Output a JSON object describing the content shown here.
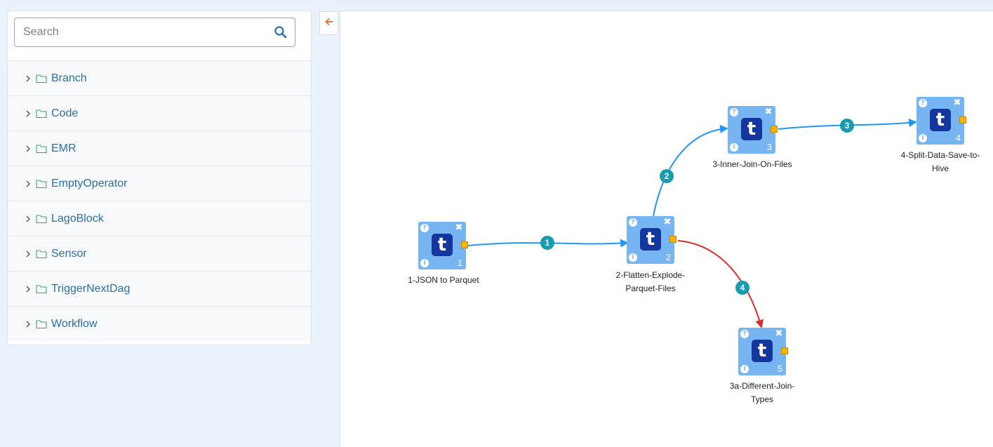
{
  "search": {
    "placeholder": "Search"
  },
  "sidebar": {
    "items": [
      {
        "label": "Branch"
      },
      {
        "label": "Code"
      },
      {
        "label": "EMR"
      },
      {
        "label": "EmptyOperator"
      },
      {
        "label": "LagoBlock"
      },
      {
        "label": "Sensor"
      },
      {
        "label": "TriggerNextDag"
      },
      {
        "label": "Workflow"
      }
    ]
  },
  "nodes": [
    {
      "logo": "t",
      "number": "1",
      "label": "1-JSON to Parquet"
    },
    {
      "logo": "t",
      "number": "2",
      "label": "2-Flatten-Explode-Parquet-Files"
    },
    {
      "logo": "t",
      "number": "3",
      "label": "3-Inner-Join-On-Files"
    },
    {
      "logo": "t",
      "number": "4",
      "label": "4-Split-Data-Save-to-Hive"
    },
    {
      "logo": "t",
      "number": "5",
      "label": "3a-Different-Join-Types"
    }
  ],
  "edges": [
    {
      "badge": "1",
      "from": "1",
      "to": "2",
      "color": "#2196f3"
    },
    {
      "badge": "2",
      "from": "2",
      "to": "3",
      "color": "#2196f3"
    },
    {
      "badge": "3",
      "from": "3",
      "to": "4",
      "color": "#2196f3"
    },
    {
      "badge": "4",
      "from": "2",
      "to": "5",
      "color": "#d32f2f"
    }
  ],
  "icons": {
    "search": "search-icon",
    "collapse": "arrow-left-icon",
    "folder": "folder-icon",
    "chevron": "chevron-right-icon",
    "help": "?",
    "info": "i",
    "close": "✖"
  },
  "colors": {
    "node": "#77b5f2",
    "logo": "#15369c",
    "port": "#f4b400",
    "badge": "#1a9cb0",
    "edge_default": "#2196f3",
    "edge_error": "#d32f2f",
    "link": "#2c6eaa"
  }
}
